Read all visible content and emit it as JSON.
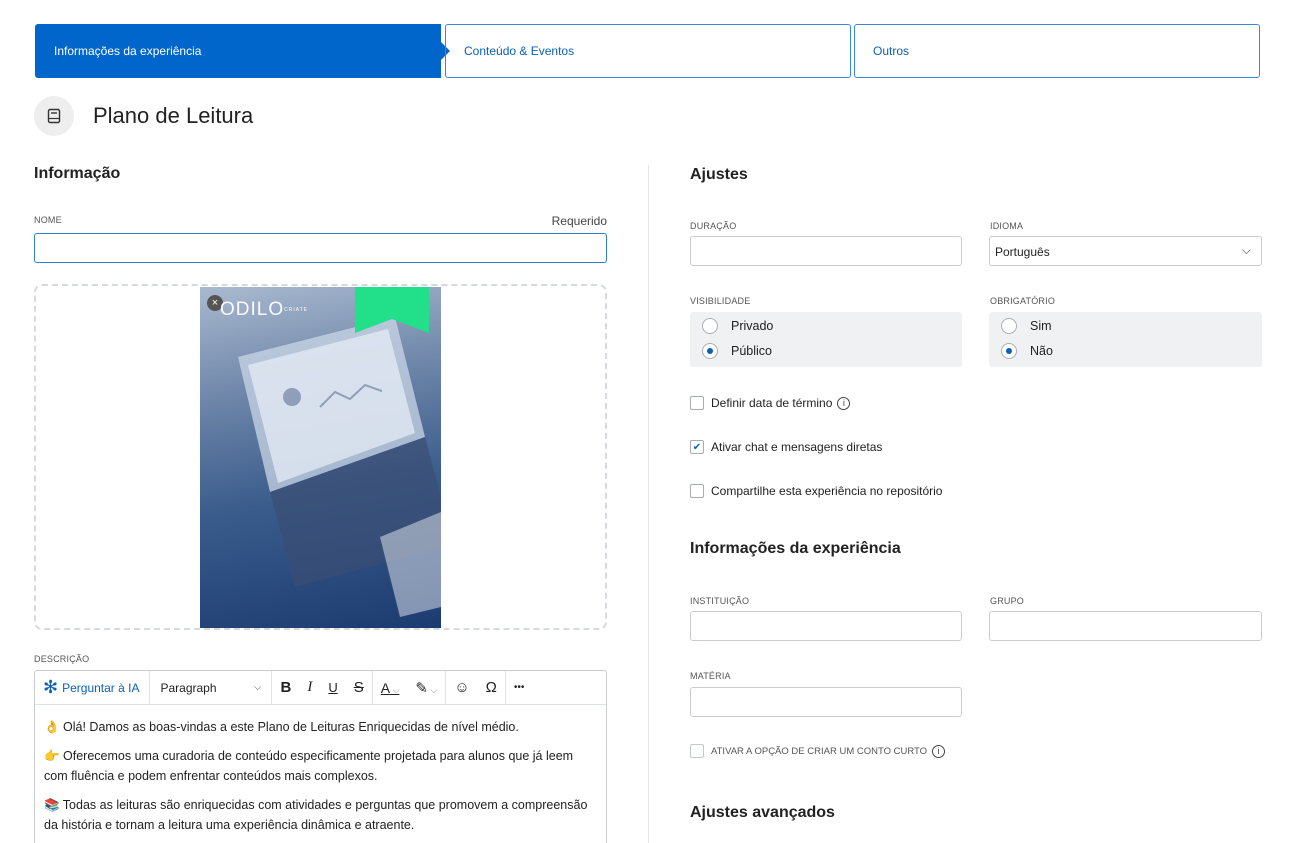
{
  "steps": {
    "step1": "Informações da experiência",
    "step2": "Conteúdo & Eventos",
    "step3": "Outros"
  },
  "title": "Plano de Leitura",
  "left": {
    "heading": "Informação",
    "name_label": "NOME",
    "required": "Requerido",
    "name_value": "",
    "cover": {
      "logo": "ODILO",
      "logo_suffix": "CRIATE"
    },
    "description_label": "DESCRIÇÃO",
    "toolbar": {
      "ai": "Perguntar à IA",
      "paragraph": "Paragraph",
      "bold": "B",
      "italic": "I",
      "underline": "U",
      "strike": "S",
      "text_color": "A",
      "omega": "Ω",
      "more": "•••"
    },
    "content": {
      "p1": "👌 Olá! Damos as boas-vindas a este Plano de Leituras Enriquecidas de nível médio.",
      "p2": "👉 Oferecemos uma curadoria de conteúdo especificamente projetada para alunos que já leem com fluência e podem enfrentar conteúdos mais complexos.",
      "p3": "📚 Todas as leituras são enriquecidas com atividades e perguntas que promovem a compreensão da história e tornam a leitura uma experiência dinâmica e atraente."
    }
  },
  "right": {
    "heading": "Ajustes",
    "duration_label": "DURAÇÃO",
    "language_label": "IDIOMA",
    "language_value": "Português",
    "visibility_label": "VISIBILIDADE",
    "visibility_options": [
      "Privado",
      "Público"
    ],
    "visibility_selected": "Público",
    "mandatory_label": "OBRIGATÓRIO",
    "mandatory_options": [
      "Sim",
      "Não"
    ],
    "mandatory_selected": "Não",
    "checks": {
      "end_date": "Definir data de término",
      "chat": "Ativar chat e mensagens diretas",
      "share": "Compartilhe esta experiência no repositório"
    },
    "info_heading": "Informações da experiência",
    "institution_label": "INSTITUIÇÃO",
    "group_label": "GRUPO",
    "subject_label": "MATÉRIA",
    "short_story": "ATIVAR A OPÇÃO DE CRIAR UM CONTO CURTO",
    "advanced_heading": "Ajustes avançados"
  },
  "colors": {
    "primary": "#0066cc",
    "bookmark": "#22e08a"
  }
}
